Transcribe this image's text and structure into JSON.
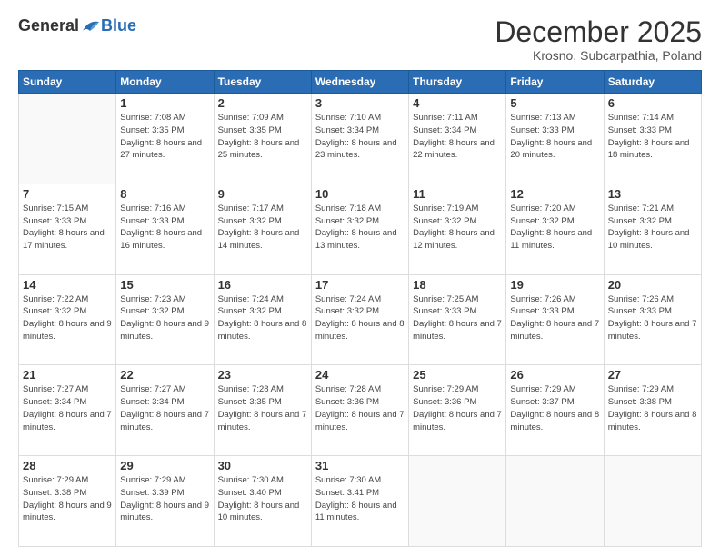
{
  "logo": {
    "general": "General",
    "blue": "Blue"
  },
  "title": "December 2025",
  "subtitle": "Krosno, Subcarpathia, Poland",
  "days_header": [
    "Sunday",
    "Monday",
    "Tuesday",
    "Wednesday",
    "Thursday",
    "Friday",
    "Saturday"
  ],
  "weeks": [
    [
      {
        "day": "",
        "sunrise": "",
        "sunset": "",
        "daylight": ""
      },
      {
        "day": "1",
        "sunrise": "Sunrise: 7:08 AM",
        "sunset": "Sunset: 3:35 PM",
        "daylight": "Daylight: 8 hours and 27 minutes."
      },
      {
        "day": "2",
        "sunrise": "Sunrise: 7:09 AM",
        "sunset": "Sunset: 3:35 PM",
        "daylight": "Daylight: 8 hours and 25 minutes."
      },
      {
        "day": "3",
        "sunrise": "Sunrise: 7:10 AM",
        "sunset": "Sunset: 3:34 PM",
        "daylight": "Daylight: 8 hours and 23 minutes."
      },
      {
        "day": "4",
        "sunrise": "Sunrise: 7:11 AM",
        "sunset": "Sunset: 3:34 PM",
        "daylight": "Daylight: 8 hours and 22 minutes."
      },
      {
        "day": "5",
        "sunrise": "Sunrise: 7:13 AM",
        "sunset": "Sunset: 3:33 PM",
        "daylight": "Daylight: 8 hours and 20 minutes."
      },
      {
        "day": "6",
        "sunrise": "Sunrise: 7:14 AM",
        "sunset": "Sunset: 3:33 PM",
        "daylight": "Daylight: 8 hours and 18 minutes."
      }
    ],
    [
      {
        "day": "7",
        "sunrise": "Sunrise: 7:15 AM",
        "sunset": "Sunset: 3:33 PM",
        "daylight": "Daylight: 8 hours and 17 minutes."
      },
      {
        "day": "8",
        "sunrise": "Sunrise: 7:16 AM",
        "sunset": "Sunset: 3:33 PM",
        "daylight": "Daylight: 8 hours and 16 minutes."
      },
      {
        "day": "9",
        "sunrise": "Sunrise: 7:17 AM",
        "sunset": "Sunset: 3:32 PM",
        "daylight": "Daylight: 8 hours and 14 minutes."
      },
      {
        "day": "10",
        "sunrise": "Sunrise: 7:18 AM",
        "sunset": "Sunset: 3:32 PM",
        "daylight": "Daylight: 8 hours and 13 minutes."
      },
      {
        "day": "11",
        "sunrise": "Sunrise: 7:19 AM",
        "sunset": "Sunset: 3:32 PM",
        "daylight": "Daylight: 8 hours and 12 minutes."
      },
      {
        "day": "12",
        "sunrise": "Sunrise: 7:20 AM",
        "sunset": "Sunset: 3:32 PM",
        "daylight": "Daylight: 8 hours and 11 minutes."
      },
      {
        "day": "13",
        "sunrise": "Sunrise: 7:21 AM",
        "sunset": "Sunset: 3:32 PM",
        "daylight": "Daylight: 8 hours and 10 minutes."
      }
    ],
    [
      {
        "day": "14",
        "sunrise": "Sunrise: 7:22 AM",
        "sunset": "Sunset: 3:32 PM",
        "daylight": "Daylight: 8 hours and 9 minutes."
      },
      {
        "day": "15",
        "sunrise": "Sunrise: 7:23 AM",
        "sunset": "Sunset: 3:32 PM",
        "daylight": "Daylight: 8 hours and 9 minutes."
      },
      {
        "day": "16",
        "sunrise": "Sunrise: 7:24 AM",
        "sunset": "Sunset: 3:32 PM",
        "daylight": "Daylight: 8 hours and 8 minutes."
      },
      {
        "day": "17",
        "sunrise": "Sunrise: 7:24 AM",
        "sunset": "Sunset: 3:32 PM",
        "daylight": "Daylight: 8 hours and 8 minutes."
      },
      {
        "day": "18",
        "sunrise": "Sunrise: 7:25 AM",
        "sunset": "Sunset: 3:33 PM",
        "daylight": "Daylight: 8 hours and 7 minutes."
      },
      {
        "day": "19",
        "sunrise": "Sunrise: 7:26 AM",
        "sunset": "Sunset: 3:33 PM",
        "daylight": "Daylight: 8 hours and 7 minutes."
      },
      {
        "day": "20",
        "sunrise": "Sunrise: 7:26 AM",
        "sunset": "Sunset: 3:33 PM",
        "daylight": "Daylight: 8 hours and 7 minutes."
      }
    ],
    [
      {
        "day": "21",
        "sunrise": "Sunrise: 7:27 AM",
        "sunset": "Sunset: 3:34 PM",
        "daylight": "Daylight: 8 hours and 7 minutes."
      },
      {
        "day": "22",
        "sunrise": "Sunrise: 7:27 AM",
        "sunset": "Sunset: 3:34 PM",
        "daylight": "Daylight: 8 hours and 7 minutes."
      },
      {
        "day": "23",
        "sunrise": "Sunrise: 7:28 AM",
        "sunset": "Sunset: 3:35 PM",
        "daylight": "Daylight: 8 hours and 7 minutes."
      },
      {
        "day": "24",
        "sunrise": "Sunrise: 7:28 AM",
        "sunset": "Sunset: 3:36 PM",
        "daylight": "Daylight: 8 hours and 7 minutes."
      },
      {
        "day": "25",
        "sunrise": "Sunrise: 7:29 AM",
        "sunset": "Sunset: 3:36 PM",
        "daylight": "Daylight: 8 hours and 7 minutes."
      },
      {
        "day": "26",
        "sunrise": "Sunrise: 7:29 AM",
        "sunset": "Sunset: 3:37 PM",
        "daylight": "Daylight: 8 hours and 8 minutes."
      },
      {
        "day": "27",
        "sunrise": "Sunrise: 7:29 AM",
        "sunset": "Sunset: 3:38 PM",
        "daylight": "Daylight: 8 hours and 8 minutes."
      }
    ],
    [
      {
        "day": "28",
        "sunrise": "Sunrise: 7:29 AM",
        "sunset": "Sunset: 3:38 PM",
        "daylight": "Daylight: 8 hours and 9 minutes."
      },
      {
        "day": "29",
        "sunrise": "Sunrise: 7:29 AM",
        "sunset": "Sunset: 3:39 PM",
        "daylight": "Daylight: 8 hours and 9 minutes."
      },
      {
        "day": "30",
        "sunrise": "Sunrise: 7:30 AM",
        "sunset": "Sunset: 3:40 PM",
        "daylight": "Daylight: 8 hours and 10 minutes."
      },
      {
        "day": "31",
        "sunrise": "Sunrise: 7:30 AM",
        "sunset": "Sunset: 3:41 PM",
        "daylight": "Daylight: 8 hours and 11 minutes."
      },
      {
        "day": "",
        "sunrise": "",
        "sunset": "",
        "daylight": ""
      },
      {
        "day": "",
        "sunrise": "",
        "sunset": "",
        "daylight": ""
      },
      {
        "day": "",
        "sunrise": "",
        "sunset": "",
        "daylight": ""
      }
    ]
  ]
}
